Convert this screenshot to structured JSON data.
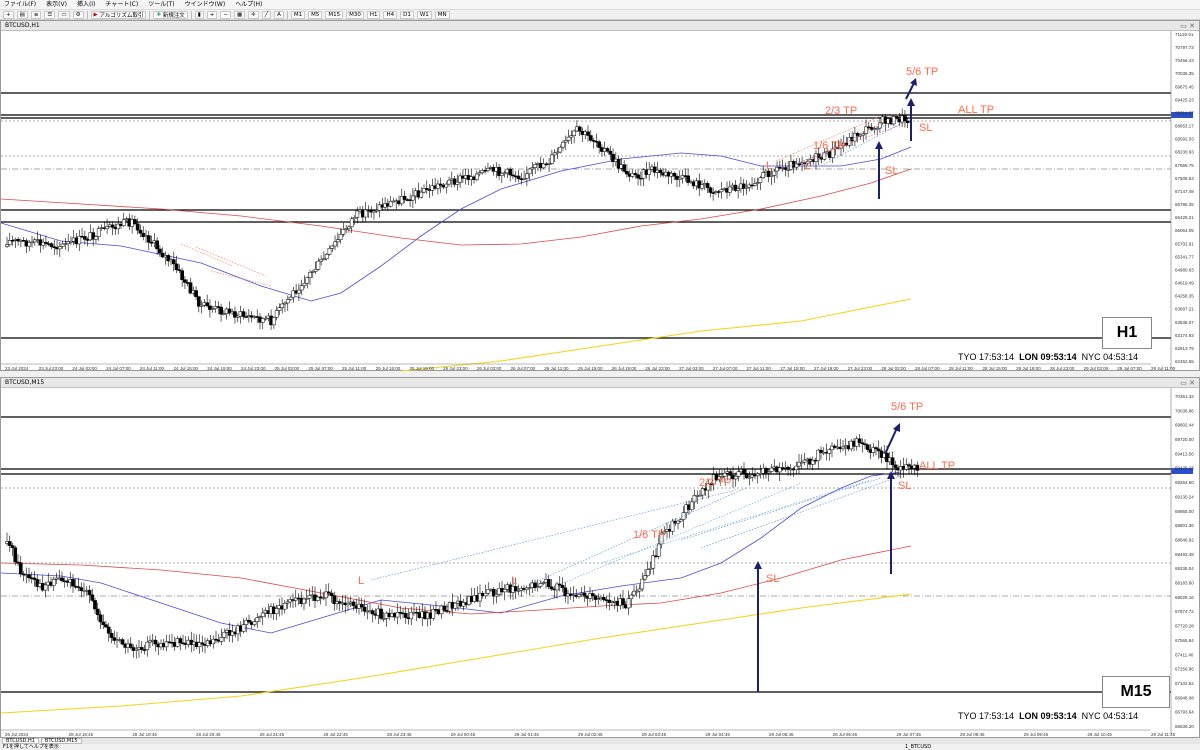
{
  "menu": [
    "ファイル(F)",
    "表示(V)",
    "挿入(I)",
    "チャート(C)",
    "ツール(T)",
    "ウインドウ(W)",
    "ヘルプ(H)"
  ],
  "account_label": "アルゴリズム取引",
  "toolbar": {
    "new_order": "新規注文",
    "timeframes": [
      "M1",
      "M5",
      "M15",
      "M30",
      "H1",
      "H4",
      "D1",
      "W1",
      "MN"
    ]
  },
  "window_h1": {
    "title": "BTCUSD,H1",
    "badge": "H1"
  },
  "window_m15": {
    "title": "BTCUSD,M15",
    "badge": "M15"
  },
  "clock": {
    "tyo": "TYO 17:53:14",
    "lon": "LON 09:53:14",
    "nyc": "NYC 04:53:14"
  },
  "h1_labels": {
    "tp56": "5/6 TP",
    "all_tp": "ALL TP",
    "tp23": "2/3 TP",
    "sl": "SL",
    "tp16": "1/6 TP",
    "l": "L"
  },
  "m15_labels": {
    "tp56": "5/6 TP",
    "all_tp": "ALL TP",
    "tp23": "2/3 TP",
    "sl": "SL",
    "tp16": "1/6 TP",
    "l": "L"
  },
  "h1_price_axis": [
    "71120.61",
    "70797.73",
    "70456.43",
    "70036.35",
    "69675.45",
    "69425.23",
    "69314.37",
    "68953.17",
    "68592.03",
    "68230.93",
    "67869.75",
    "67508.63",
    "67147.49",
    "66786.35",
    "66425.21",
    "66064.05",
    "65702.91",
    "65341.77",
    "64980.63",
    "64619.49",
    "64258.35",
    "63897.21",
    "63536.07",
    "63174.93",
    "62813.79",
    "62452.65"
  ],
  "h1_time_axis": [
    "23 Jul 2024",
    "23 Jul 23:00",
    "24 Jul 03:00",
    "24 Jul 07:00",
    "24 Jul 11:00",
    "24 Jul 15:00",
    "24 Jul 19:00",
    "24 Jul 23:00",
    "25 Jul 03:00",
    "25 Jul 07:00",
    "25 Jul 11:00",
    "25 Jul 15:00",
    "25 Jul 19:00",
    "25 Jul 23:00",
    "26 Jul 03:00",
    "26 Jul 07:00",
    "26 Jul 11:00",
    "26 Jul 15:00",
    "26 Jul 19:00",
    "26 Jul 23:00",
    "27 Jul 03:00",
    "27 Jul 07:00",
    "27 Jul 11:00",
    "27 Jul 15:00",
    "27 Jul 19:00",
    "27 Jul 23:00",
    "28 Jul 03:00",
    "28 Jul 07:00",
    "28 Jul 11:00",
    "28 Jul 15:00",
    "28 Jul 19:00",
    "28 Jul 23:00",
    "29 Jul 03:00",
    "29 Jul 07:00",
    "29 Jul 11:00"
  ],
  "m15_price_axis": [
    "70351.32",
    "70036.86",
    "69802.44",
    "69720.00",
    "69413.56",
    "69425.23",
    "69264.60",
    "69130.24",
    "68955.00",
    "68801.36",
    "68646.92",
    "68492.48",
    "68338.04",
    "68183.60",
    "68029.16",
    "67874.72",
    "67720.28",
    "67565.84",
    "67411.40",
    "67256.96",
    "67102.52",
    "66948.08",
    "66793.64",
    "66639.20"
  ],
  "m15_time_axis": [
    "26 Jul 2024",
    "28 Jul 18:45",
    "28 Jul 19:45",
    "28 Jul 20:45",
    "28 Jul 21:45",
    "28 Jul 22:45",
    "28 Jul 23:45",
    "29 Jul 00:45",
    "29 Jul 01:45",
    "29 Jul 02:45",
    "29 Jul 03:45",
    "29 Jul 04:45",
    "29 Jul 05:45",
    "29 Jul 06:45",
    "29 Jul 07:45",
    "29 Jul 08:45",
    "29 Jul 09:45",
    "29 Jul 10:45",
    "29 Jul 11:45"
  ],
  "tabs": [
    "BTCUSD,H1",
    "BTCUSD,M15"
  ],
  "status": {
    "left": "F1を押してヘルプを表示",
    "right": "1_BTCUSD"
  },
  "colors": {
    "annotation": "#ff6b4a",
    "arrow": "#1c1f6e",
    "ma_fast": "#4a4ad8",
    "ma_slow": "#e04848",
    "ma_long": "#f5d31a"
  },
  "icons": [
    "new-chart-icon",
    "profiles-icon",
    "market-watch-icon",
    "navigator-icon",
    "terminal-icon",
    "strategy-tester-icon",
    "algo-trading-icon",
    "new-order-icon",
    "chart-type-icon",
    "zoom-in-icon",
    "zoom-out-icon",
    "tile-windows-icon",
    "crosshair-icon",
    "trendline-icon",
    "text-icon"
  ]
}
